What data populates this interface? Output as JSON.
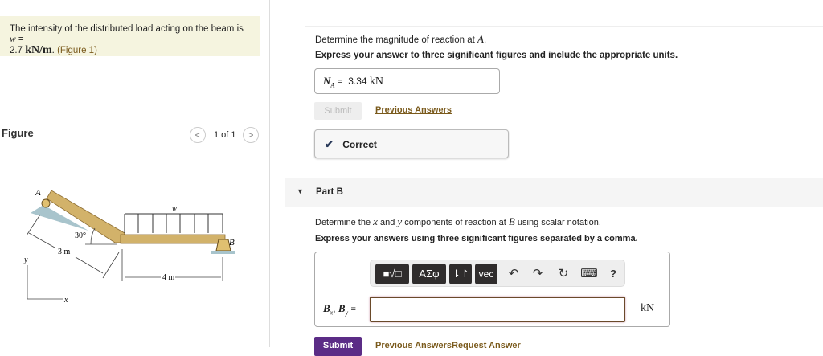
{
  "problem": {
    "intro": "The intensity of the distributed load acting on the beam is",
    "var": "w",
    "eq": "=",
    "value": "2.7",
    "unit": "kN/m",
    "suffix": ".",
    "figure_link": "(Figure 1)"
  },
  "figure": {
    "label": "Figure",
    "pager": "1 of 1",
    "prev": "<",
    "next": ">",
    "diagram": {
      "point_a": "A",
      "point_b": "B",
      "load": "w",
      "angle": "30°",
      "len1": "3 m",
      "len2": "4 m",
      "axis_x": "x",
      "axis_y": "y"
    }
  },
  "partA": {
    "prompt": "Determine the magnitude of reaction at",
    "prompt_var": "A",
    "prompt_end": ".",
    "instructions": "Express your answer to three significant figures and include the appropriate units.",
    "answer_label": "N",
    "answer_sub": "A",
    "answer_eq": "=",
    "answer_value": "3.34",
    "answer_unit": "kN",
    "submit": "Submit",
    "previous_answers": "Previous Answers",
    "feedback": "Correct"
  },
  "partB": {
    "title": "Part B",
    "prompt_pre": "Determine the",
    "x": "x",
    "and": "and",
    "y": "y",
    "prompt_mid": "components of reaction at",
    "b": "B",
    "prompt_end": "using scalar notation.",
    "instructions": "Express your answers using three significant figures separated by a comma.",
    "toolbar": {
      "templates": "■√□",
      "greek": "ΑΣφ",
      "arrows": "⇂↾",
      "vec": "vec",
      "undo": "↶",
      "redo": "↷",
      "reset": "↻",
      "keyboard": "⌨",
      "help": "?"
    },
    "answer_label": "B",
    "sub_x": "x",
    "sep": ",",
    "sub_y": "y",
    "answer_eq": "=",
    "answer_value": "",
    "unit": "kN",
    "submit": "Submit",
    "previous_answers": "Previous Answers",
    "request_answer": "Request Answer"
  }
}
